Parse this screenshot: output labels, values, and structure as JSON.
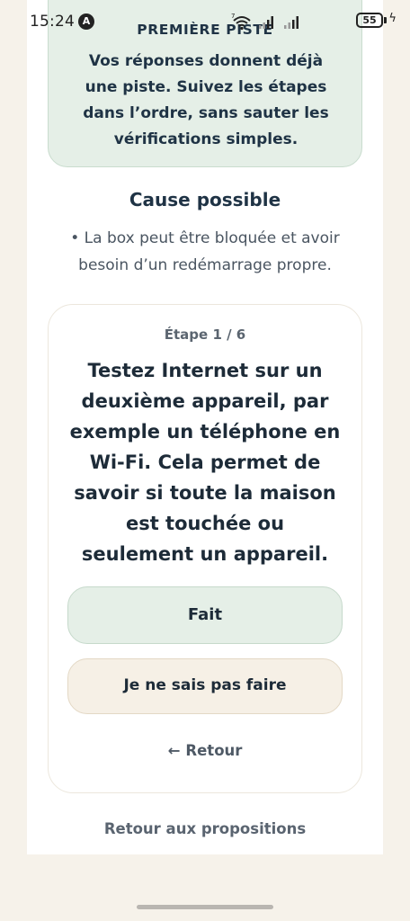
{
  "status_bar": {
    "time": "15:24",
    "battery_level": "55",
    "icons": [
      "app-notification-icon",
      "wifi-icon",
      "signal-icon",
      "signal-icon",
      "battery-icon",
      "charging-bolt-icon"
    ]
  },
  "intro": {
    "title": "PREMIÈRE PISTE",
    "text": "Vos réponses donnent déjà une piste. Suivez les étapes dans l’ordre, sans sauter les vérifications simples."
  },
  "cause": {
    "title": "Cause possible",
    "text": "• La box peut être bloquée et avoir besoin d’un redémarrage propre."
  },
  "step": {
    "counter": "Étape 1 / 6",
    "text": "Testez Internet sur un deuxième appareil, par exemple un téléphone en Wi-Fi. Cela permet de savoir si toute la maison est touchée ou seulement un appareil.",
    "done_label": "Fait",
    "dont_know_label": "Je ne sais pas faire",
    "back_arrow": "←",
    "back_label": "Retour"
  },
  "footer": {
    "proposals_label": "Retour aux propositions"
  },
  "colors": {
    "background": "#f6f2ea",
    "green_card": "#e5efe7",
    "beige_button": "#f6f0e6",
    "text_dark": "#1d2b38"
  }
}
